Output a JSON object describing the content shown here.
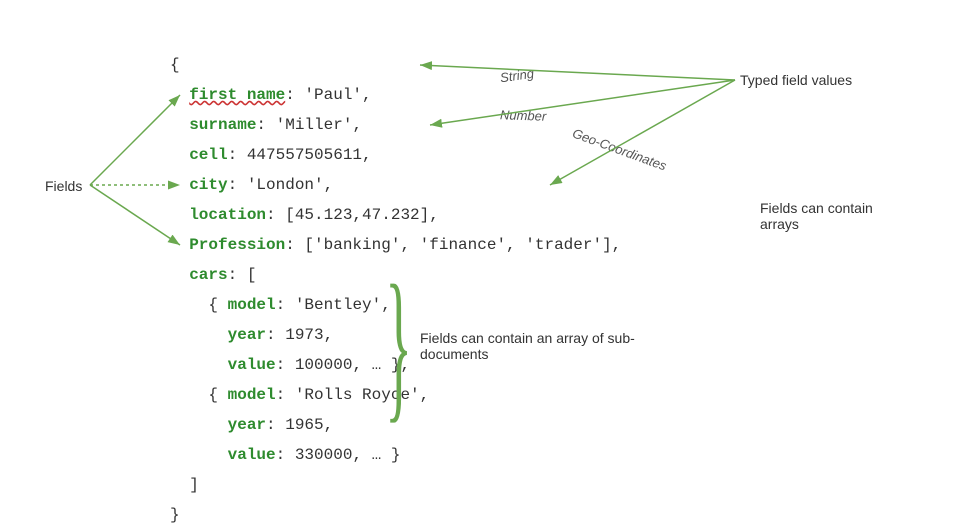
{
  "labels": {
    "fields": "Fields",
    "typed": "Typed field values",
    "arrays": "Fields can contain arrays",
    "subdocs": "Fields can contain an array of sub-documents"
  },
  "arrow_labels": {
    "string": "String",
    "number": "Number",
    "geo": "Geo-Coordinates"
  },
  "doc": {
    "open_brace": "{",
    "close_brace": "}",
    "close_bracket": "]",
    "first_name_key": "first name",
    "first_name_sep": ": ",
    "first_name_val": "'Paul'",
    "surname_key": "surname",
    "surname_sep": ": ",
    "surname_val": "'Miller'",
    "cell_key": "cell",
    "cell_sep": ": ",
    "cell_val": "447557505611",
    "city_key": "city",
    "city_sep": ": ",
    "city_val": "'London'",
    "location_key": "location",
    "location_sep": ": ",
    "location_val": "[45.123,47.232]",
    "profession_key": "Profession",
    "profession_sep": ": ",
    "profession_val": "['banking', 'finance', 'trader']",
    "cars_key": "cars",
    "cars_sep": ": [",
    "car1_model_key": "model",
    "car1_model_sep": ": ",
    "car1_model_val": "'Bentley'",
    "car1_year_key": "year",
    "car1_year_sep": ": ",
    "car1_year_val": "1973",
    "car1_value_key": "value",
    "car1_value_sep": ": ",
    "car1_value_val": "100000, … }",
    "car2_model_key": "model",
    "car2_model_sep": ": ",
    "car2_model_val": "'Rolls Royce'",
    "car2_year_key": "year",
    "car2_year_sep": ": ",
    "car2_year_val": "1965",
    "car2_value_key": "value",
    "car2_value_sep": ": ",
    "car2_value_val": "330000, … }",
    "comma": ",",
    "open_obj": "{ ",
    "indent2": "  ",
    "indent4": "    "
  },
  "colors": {
    "arrow": "#6aa84f"
  }
}
